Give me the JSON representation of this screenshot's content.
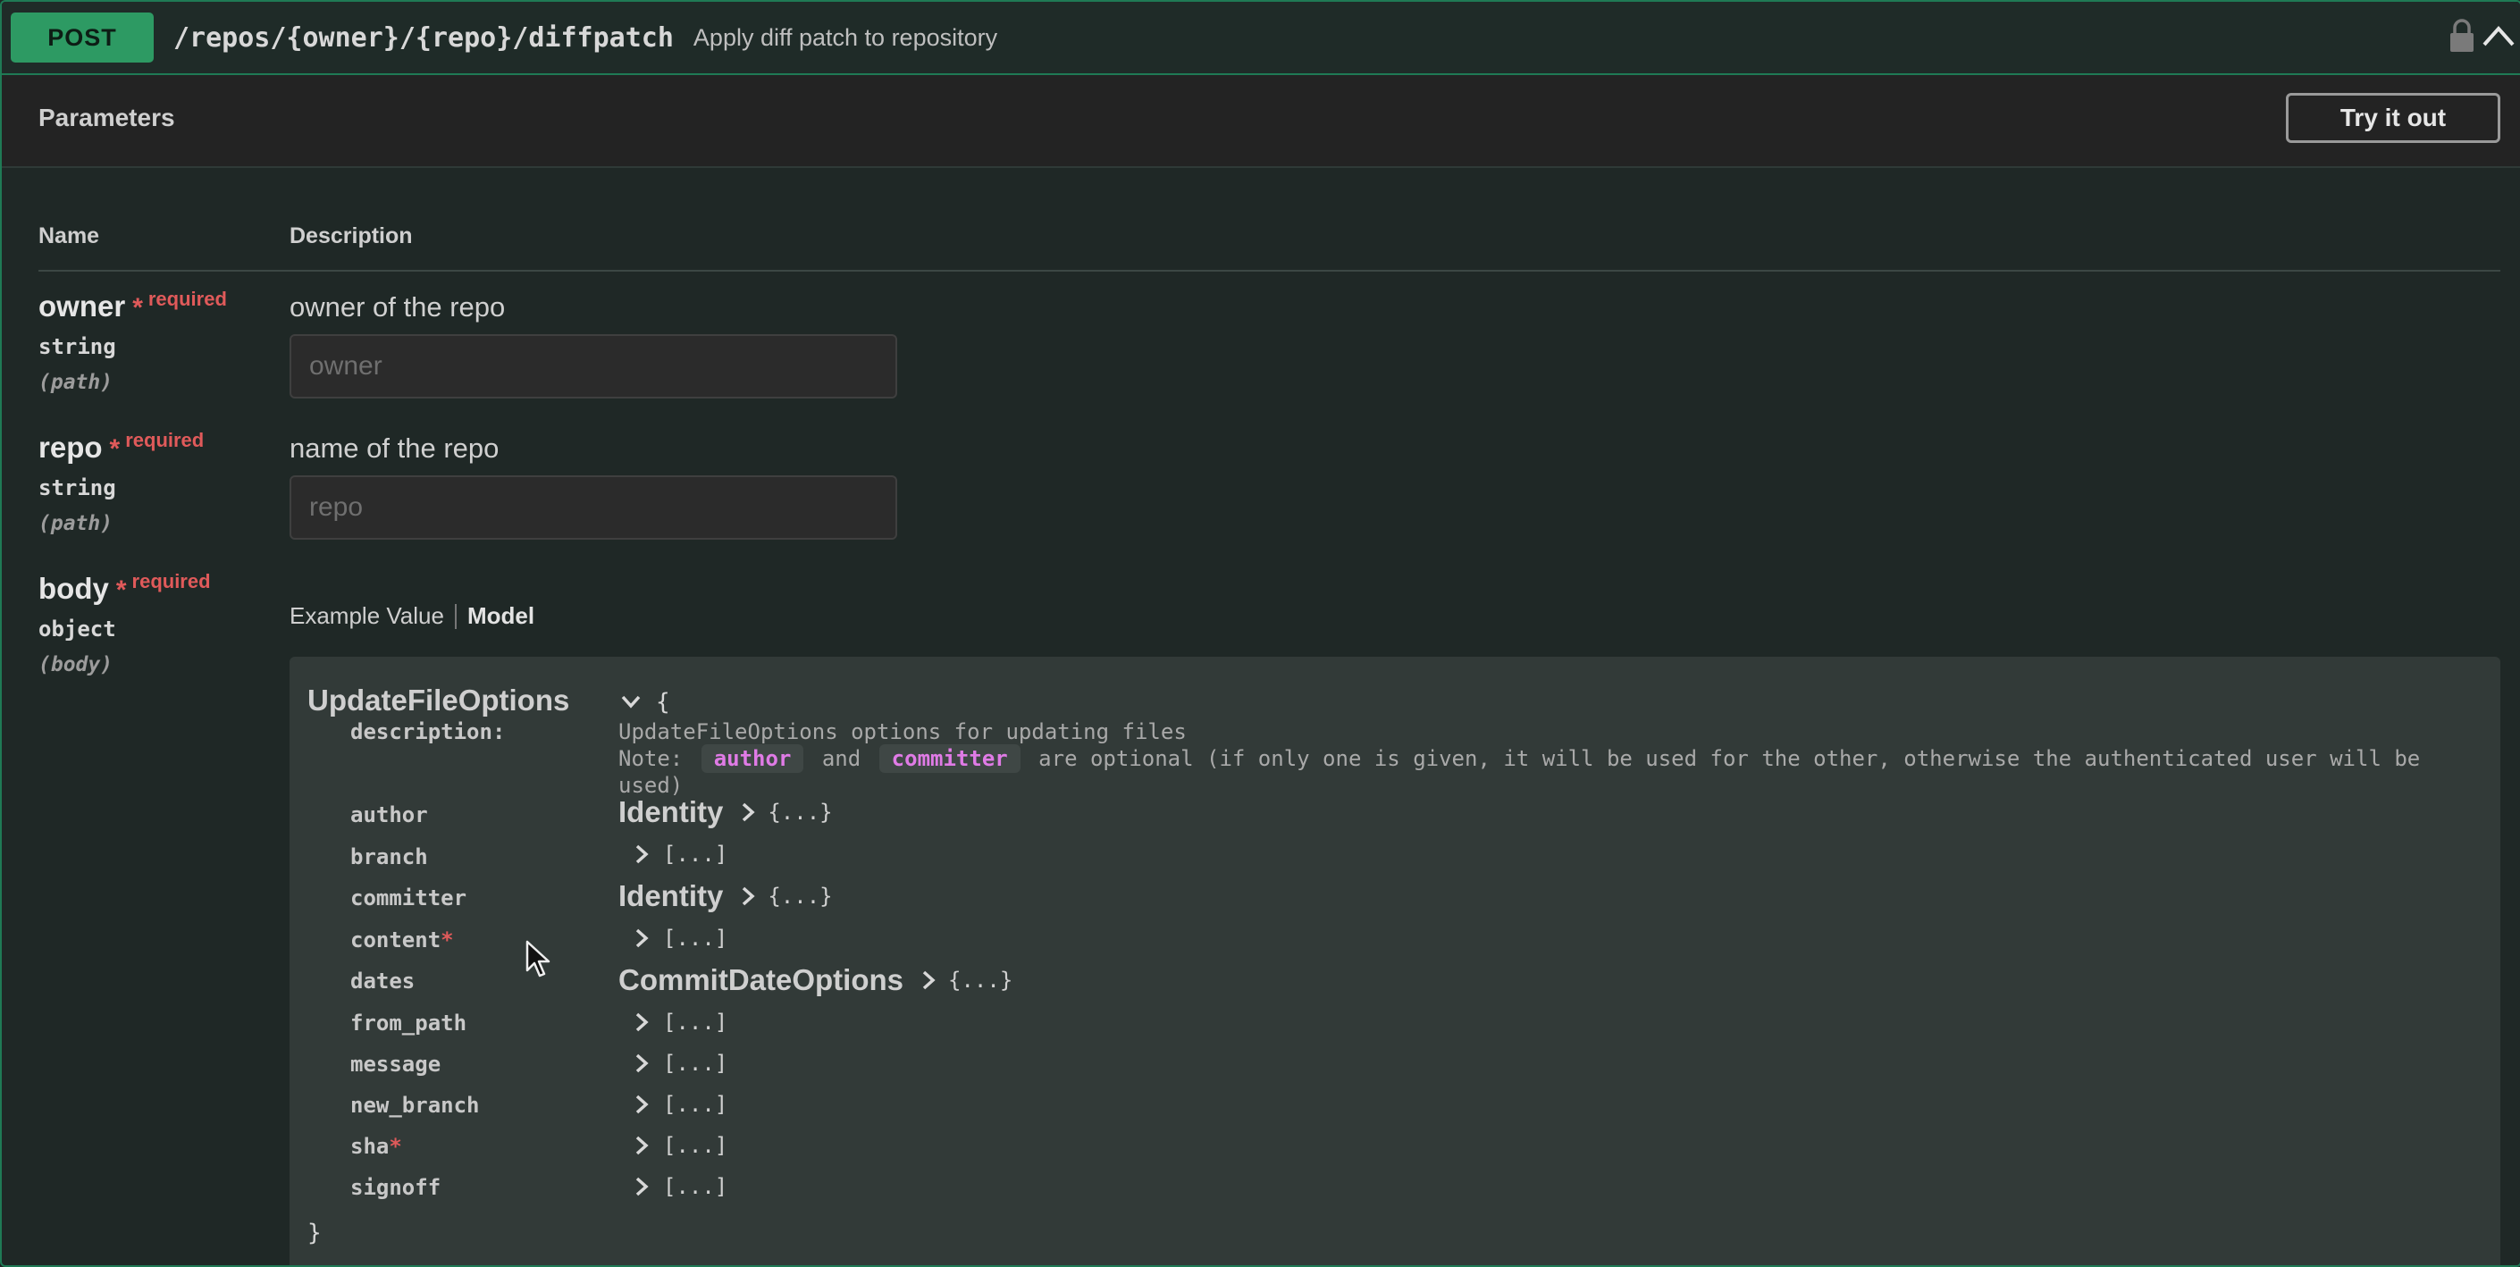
{
  "operation": {
    "method": "POST",
    "path": "/repos/{owner}/{repo}/diffpatch",
    "summary": "Apply diff patch to repository"
  },
  "parameters_section": {
    "title": "Parameters",
    "try_button": "Try it out",
    "col_name": "Name",
    "col_description": "Description"
  },
  "params": [
    {
      "name": "owner",
      "required": "required",
      "type": "string",
      "in": "(path)",
      "description": "owner of the repo",
      "placeholder": "owner"
    },
    {
      "name": "repo",
      "required": "required",
      "type": "string",
      "in": "(path)",
      "description": "name of the repo",
      "placeholder": "repo"
    },
    {
      "name": "body",
      "required": "required",
      "type": "object",
      "in": "(body)"
    }
  ],
  "body_tabs": {
    "example": "Example Value",
    "model": "Model"
  },
  "model": {
    "name": "UpdateFileOptions",
    "open_brace": "{",
    "close_brace": "}",
    "description_key": "description:",
    "description_line1": "UpdateFileOptions options for updating files",
    "note_prefix": "Note:",
    "note_code1": "author",
    "note_and": "and",
    "note_code2": "committer",
    "note_suffix": "are optional (if only one is given, it will be used for the other, otherwise the authenticated user will be",
    "note_line3": "used)",
    "properties": [
      {
        "name": "author",
        "required": ""
      },
      {
        "name": "branch",
        "required": ""
      },
      {
        "name": "committer",
        "required": ""
      },
      {
        "name": "content",
        "required": "*"
      },
      {
        "name": "dates",
        "required": ""
      },
      {
        "name": "from_path",
        "required": ""
      },
      {
        "name": "message",
        "required": ""
      },
      {
        "name": "new_branch",
        "required": ""
      },
      {
        "name": "sha",
        "required": "*"
      },
      {
        "name": "signoff",
        "required": ""
      }
    ],
    "values": [
      {
        "kind": "ref",
        "label": "Identity",
        "collapsed": "{...}"
      },
      {
        "kind": "array",
        "collapsed": "[...]"
      },
      {
        "kind": "ref",
        "label": "Identity",
        "collapsed": "{...}"
      },
      {
        "kind": "array",
        "collapsed": "[...]"
      },
      {
        "kind": "ref",
        "label": "CommitDateOptions",
        "collapsed": "{...}"
      },
      {
        "kind": "array",
        "collapsed": "[...]"
      },
      {
        "kind": "array",
        "collapsed": "[...]"
      },
      {
        "kind": "array",
        "collapsed": "[...]"
      },
      {
        "kind": "array",
        "collapsed": "[...]"
      },
      {
        "kind": "array",
        "collapsed": "[...]"
      }
    ]
  },
  "colors": {
    "post_green": "#2d9a63",
    "border_green": "#1f7a55",
    "required_red": "#e05a5a",
    "code_pink": "#e07be6"
  },
  "icons": [
    "lock-icon",
    "chevron-up-icon",
    "chevron-down-icon",
    "chevron-right-icon",
    "mouse-cursor-icon"
  ]
}
